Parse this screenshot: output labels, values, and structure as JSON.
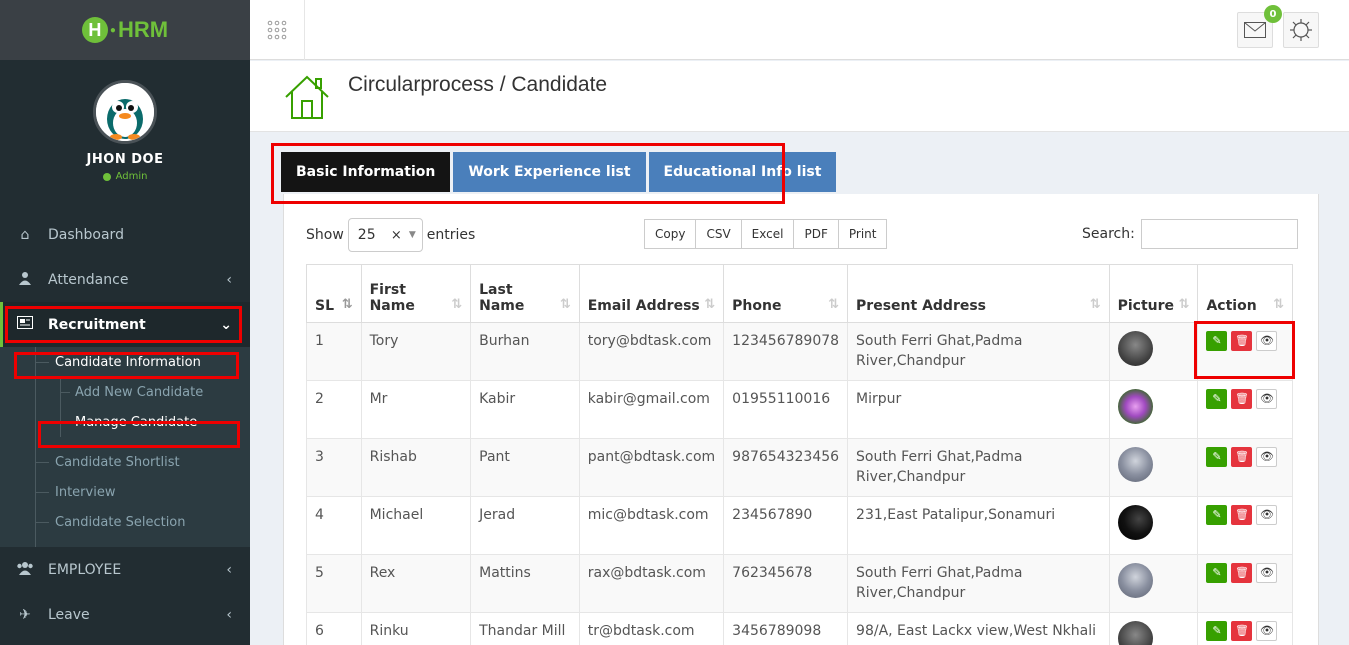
{
  "app": {
    "logo_text": "HRM"
  },
  "user": {
    "name": "JHON DOE",
    "role": "Admin"
  },
  "sidebar": {
    "items": [
      {
        "label": "Dashboard",
        "icon": "home-icon"
      },
      {
        "label": "Attendance",
        "icon": "user-icon"
      },
      {
        "label": "Recruitment",
        "icon": "newspaper-icon"
      },
      {
        "label": "EMPLOYEE",
        "icon": "users-icon"
      },
      {
        "label": "Leave",
        "icon": "plane-icon"
      }
    ],
    "submenu": {
      "candidate_information": "Candidate Information",
      "add_new_candidate": "Add New Candidate",
      "manage_candidate": "Manage Candidate",
      "candidate_shortlist": "Candidate Shortlist",
      "interview": "Interview",
      "candidate_selection": "Candidate Selection"
    }
  },
  "topbar": {
    "notification_count": "0"
  },
  "header": {
    "title": "Circularprocess / Candidate"
  },
  "tabs": [
    {
      "label": "Basic Information"
    },
    {
      "label": "Work Experience list"
    },
    {
      "label": "Educational Info list"
    }
  ],
  "controls": {
    "show_label": "Show",
    "entries_value": "25",
    "entries_label": "entries",
    "export_buttons": [
      "Copy",
      "CSV",
      "Excel",
      "PDF",
      "Print"
    ],
    "search_label": "Search:"
  },
  "table": {
    "headers": [
      "SL",
      "First Name",
      "Last Name",
      "Email Address",
      "Phone",
      "Present Address",
      "Picture",
      "Action"
    ],
    "rows": [
      {
        "sl": "1",
        "first": "Tory",
        "last": "Burhan",
        "email": "tory@bdtask.com",
        "phone": "123456789078",
        "address": "South Ferri Ghat,Padma River,Chandpur"
      },
      {
        "sl": "2",
        "first": "Mr",
        "last": "Kabir",
        "email": "kabir@gmail.com",
        "phone": "01955110016",
        "address": "Mirpur"
      },
      {
        "sl": "3",
        "first": "Rishab",
        "last": "Pant",
        "email": "pant@bdtask.com",
        "phone": "987654323456",
        "address": "South Ferri Ghat,Padma River,Chandpur"
      },
      {
        "sl": "4",
        "first": "Michael",
        "last": "Jerad",
        "email": "mic@bdtask.com",
        "phone": "234567890",
        "address": "231,East Patalipur,Sonamuri"
      },
      {
        "sl": "5",
        "first": "Rex",
        "last": "Mattins",
        "email": "rax@bdtask.com",
        "phone": "762345678",
        "address": "South Ferri Ghat,Padma River,Chandpur"
      },
      {
        "sl": "6",
        "first": "Rinku",
        "last": "Thandar Mill",
        "email": "tr@bdtask.com",
        "phone": "3456789098",
        "address": "98/A, East Lackx view,West Nkhali"
      }
    ]
  },
  "colors": {
    "accent": "#6fc03a",
    "tab_blue": "#4a7fbb",
    "sidebar": "#222d32",
    "highlight": "#e00000"
  }
}
